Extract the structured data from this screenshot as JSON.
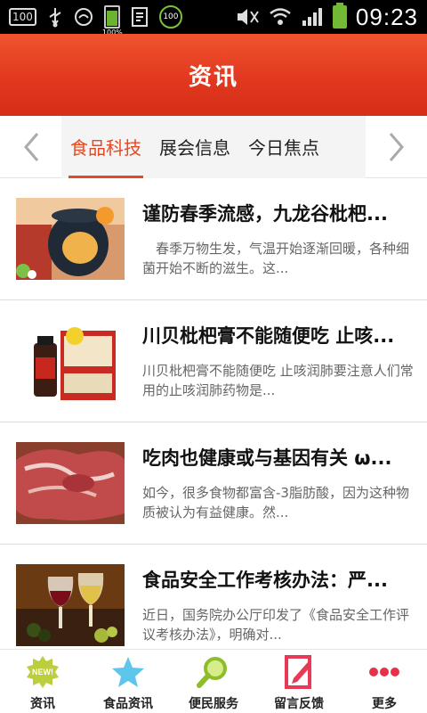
{
  "status_bar": {
    "box_label": "100",
    "battery_percent_label": "100%",
    "circle_label": "100",
    "time": "09:23"
  },
  "header": {
    "title": "资讯"
  },
  "tabs": [
    {
      "label": "食品科技",
      "active": true
    },
    {
      "label": "展会信息",
      "active": false
    },
    {
      "label": "今日焦点",
      "active": false
    }
  ],
  "news": [
    {
      "title": "谨防春季流感，九龙谷枇杷...",
      "summary": "　春季万物生发，气温开始逐渐回暖，各种细菌开始不断的滋生。这..."
    },
    {
      "title": "川贝枇杷膏不能随便吃 止咳...",
      "summary": "川贝枇杷膏不能随便吃 止咳润肺要注意人们常用的止咳润肺药物是..."
    },
    {
      "title": "吃肉也健康或与基因有关 ω...",
      "summary": "如今，很多食物都富含-3脂肪酸，因为这种物质被认为有益健康。然..."
    },
    {
      "title": "食品安全工作考核办法：严...",
      "summary": "近日，国务院办公厅印发了《食品安全工作评议考核办法》，明确对..."
    }
  ],
  "bottom_nav": [
    {
      "label": "资讯",
      "icon": "new-badge-icon",
      "badge_text": "NEW!"
    },
    {
      "label": "食品资讯",
      "icon": "star-icon"
    },
    {
      "label": "便民服务",
      "icon": "magnifier-icon"
    },
    {
      "label": "留言反馈",
      "icon": "edit-note-icon"
    },
    {
      "label": "更多",
      "icon": "more-dots-icon"
    }
  ],
  "colors": {
    "accent": "#e24a23",
    "header": "#e0361e"
  }
}
